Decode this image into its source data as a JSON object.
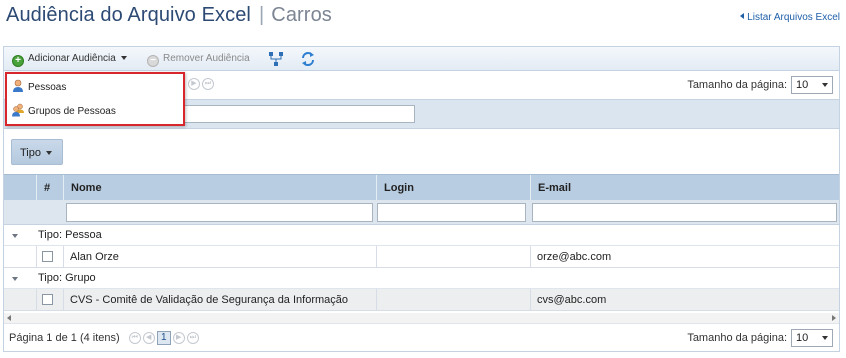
{
  "header": {
    "title": "Audiência do Arquivo Excel",
    "subtitle": "Carros",
    "back_link": "Listar Arquivos Excel"
  },
  "toolbar": {
    "add_label": "Adicionar Audiência",
    "remove_label": "Remover Audiência"
  },
  "menu": {
    "items": [
      {
        "label": "Pessoas",
        "icon": "person-icon"
      },
      {
        "label": "Grupos de Pessoas",
        "icon": "people-group-icon"
      }
    ]
  },
  "pager": {
    "page_size_label": "Tamanho da página:",
    "page_size_value": "10",
    "page_info": "Página 1 de 1 (4 itens)",
    "current_page": "1"
  },
  "group_by": {
    "chip_label": "Tipo"
  },
  "table": {
    "columns": [
      "#",
      "Nome",
      "Login",
      "E-mail"
    ],
    "groups": [
      {
        "label": "Tipo: Pessoa",
        "rows": [
          {
            "name": "Alan Orze",
            "login": "",
            "email": "orze@abc.com"
          }
        ]
      },
      {
        "label": "Tipo: Grupo",
        "rows": [
          {
            "name": "CVS - Comitê de Validação de Segurança da Informação",
            "login": "",
            "email": "cvs@abc.com"
          }
        ]
      }
    ]
  },
  "colors": {
    "title": "#2c4a74",
    "link": "#1f5fa8",
    "header_bg": "#b8cde2",
    "highlight_border": "#d8262d"
  }
}
